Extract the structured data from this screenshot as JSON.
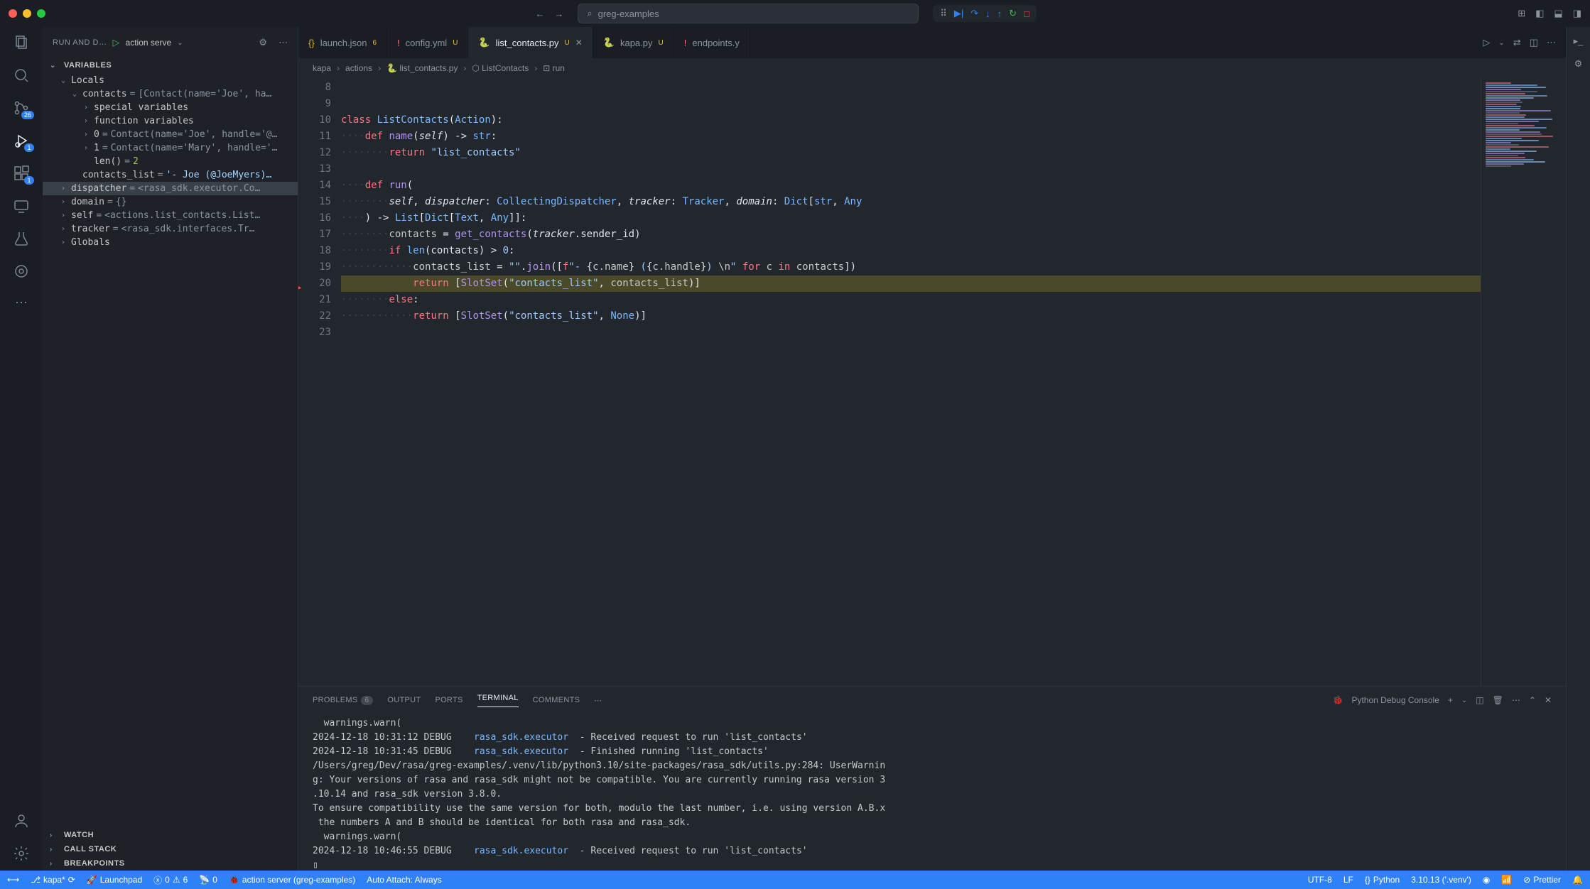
{
  "titlebar": {
    "search_text": "greg-examples"
  },
  "activity": {
    "scm_badge": "26",
    "debug_badge": "1",
    "ext_badge": "1"
  },
  "sidebar": {
    "title": "RUN AND D…",
    "config": "action serve",
    "sections": {
      "variables": "VARIABLES",
      "locals": "Locals",
      "globals": "Globals",
      "watch": "WATCH",
      "callstack": "CALL STACK",
      "breakpoints": "BREAKPOINTS"
    },
    "vars": {
      "contacts": "contacts",
      "contacts_val": "[Contact(name='Joe', ha…",
      "special": "special variables",
      "funcvars": "function variables",
      "idx0": "0",
      "idx0_val": "Contact(name='Joe', handle='@…",
      "idx1": "1",
      "idx1_val": "Contact(name='Mary', handle='…",
      "len": "len()",
      "len_val": "2",
      "clist": "contacts_list",
      "clist_val": "'- Joe (@JoeMyers)…",
      "dispatcher": "dispatcher",
      "dispatcher_val": "<rasa_sdk.executor.Co…",
      "domain": "domain",
      "domain_val": "{}",
      "selfv": "self",
      "self_val": "<actions.list_contacts.List…",
      "tracker": "tracker",
      "tracker_val": "<rasa_sdk.interfaces.Tr…"
    }
  },
  "tabs": [
    {
      "icon": "{}",
      "icon_color": "#e3b341",
      "name": "launch.json",
      "mod": "6"
    },
    {
      "icon": "!",
      "icon_color": "#f97583",
      "name": "config.yml",
      "mod": "U"
    },
    {
      "icon": "py",
      "icon_color": "#79b8ff",
      "name": "list_contacts.py",
      "mod": "U",
      "active": true,
      "close": true
    },
    {
      "icon": "py",
      "icon_color": "#79b8ff",
      "name": "kapa.py",
      "mod": "U"
    },
    {
      "icon": "!",
      "icon_color": "#f97583",
      "name": "endpoints.y"
    }
  ],
  "breadcrumb": [
    "kapa",
    "actions",
    "list_contacts.py",
    "ListContacts",
    "run"
  ],
  "code": {
    "lines": [
      {
        "n": 8,
        "html": ""
      },
      {
        "n": 9,
        "html": ""
      },
      {
        "n": 10,
        "html": "<span class='kw'>class</span> <span class='cls'>ListContacts</span><span class='punct'>(</span><span class='cls'>Action</span><span class='punct'>):</span>"
      },
      {
        "n": 11,
        "html": "<span class='dots'>····</span><span class='kw'>def</span> <span class='fn'>name</span><span class='punct'>(</span><span class='self'>self</span><span class='punct'>) -&gt; </span><span class='builtin'>str</span><span class='punct'>:</span>"
      },
      {
        "n": 12,
        "html": "<span class='dots'>········</span><span class='kw'>return</span> <span class='str'>\"list_contacts\"</span>"
      },
      {
        "n": 13,
        "html": ""
      },
      {
        "n": 14,
        "html": "<span class='dots'>····</span><span class='kw'>def</span> <span class='fn'>run</span><span class='punct'>(</span>"
      },
      {
        "n": 15,
        "html": "<span class='dots'>········</span><span class='self'>self</span><span class='punct'>, </span><span class='param'>dispatcher</span><span class='punct'>: </span><span class='cls'>CollectingDispatcher</span><span class='punct'>, </span><span class='param'>tracker</span><span class='punct'>: </span><span class='cls'>Tracker</span><span class='punct'>, </span><span class='param'>domain</span><span class='punct'>: </span><span class='cls'>Dict</span><span class='punct'>[</span><span class='builtin'>str</span><span class='punct'>, </span><span class='cls'>Any</span>"
      },
      {
        "n": 16,
        "html": "<span class='dots'>····</span><span class='punct'>) -&gt; </span><span class='cls'>List</span><span class='punct'>[</span><span class='cls'>Dict</span><span class='punct'>[</span><span class='cls'>Text</span><span class='punct'>, </span><span class='cls'>Any</span><span class='punct'>]]:</span>"
      },
      {
        "n": 17,
        "html": "<span class='dots'>········</span>contacts <span class='op'>=</span> <span class='fn'>get_contacts</span><span class='punct'>(</span><span class='param'>tracker</span><span class='punct'>.sender_id)</span>"
      },
      {
        "n": 18,
        "html": "<span class='dots'>········</span><span class='kw'>if</span> <span class='builtin'>len</span><span class='punct'>(contacts) &gt; </span><span class='str'>0</span><span class='punct'>:</span>"
      },
      {
        "n": 19,
        "html": "<span class='dots'>············</span>contacts_list <span class='op'>=</span> <span class='str'>\"\"</span><span class='punct'>.</span><span class='fn'>join</span><span class='punct'>([</span><span class='kw'>f</span><span class='str'>\"- </span><span class='punct'>{</span>c.name<span class='punct'>}</span><span class='str'> (</span><span class='punct'>{</span>c.handle<span class='punct'>}</span><span class='str'>) </span>\\n<span class='str'>\"</span> <span class='kw'>for</span> c <span class='kw'>in</span> contacts<span class='punct'>])</span>"
      },
      {
        "n": 20,
        "html": "<span class='dots'>············</span><span class='kw'>return</span> <span class='punct'>[</span><span class='fn'>SlotSet</span><span class='punct'>(</span><span class='str'>\"contacts_list\"</span><span class='punct'>, </span>contacts_list<span class='punct'>)]</span>",
        "current": true,
        "bp": true
      },
      {
        "n": 21,
        "html": "<span class='dots'>········</span><span class='kw'>else</span><span class='punct'>:</span>"
      },
      {
        "n": 22,
        "html": "<span class='dots'>············</span><span class='kw'>return</span> <span class='punct'>[</span><span class='fn'>SlotSet</span><span class='punct'>(</span><span class='str'>\"contacts_list\"</span><span class='punct'>, </span><span class='builtin'>None</span><span class='punct'>)]</span>"
      },
      {
        "n": 23,
        "html": ""
      }
    ]
  },
  "panel": {
    "problems": "PROBLEMS",
    "problems_count": "6",
    "output": "OUTPUT",
    "ports": "PORTS",
    "terminal": "TERMINAL",
    "comments": "COMMENTS",
    "console": "Python Debug Console",
    "terminal_lines": [
      "  warnings.warn(",
      "2024-12-18 10:31:12 DEBUG    rasa_sdk.executor  - Received request to run 'list_contacts'",
      "2024-12-18 10:31:45 DEBUG    rasa_sdk.executor  - Finished running 'list_contacts'",
      "/Users/greg/Dev/rasa/greg-examples/.venv/lib/python3.10/site-packages/rasa_sdk/utils.py:284: UserWarnin",
      "g: Your versions of rasa and rasa_sdk might not be compatible. You are currently running rasa version 3",
      ".10.14 and rasa_sdk version 3.8.0.",
      "To ensure compatibility use the same version for both, modulo the last number, i.e. using version A.B.x",
      " the numbers A and B should be identical for both rasa and rasa_sdk.",
      "  warnings.warn(",
      "2024-12-18 10:46:55 DEBUG    rasa_sdk.executor  - Received request to run 'list_contacts'",
      "▯"
    ]
  },
  "statusbar": {
    "branch": "kapa*",
    "launchpad": "Launchpad",
    "errors": "0",
    "warnings": "6",
    "ports": "0",
    "debug_target": "action server (greg-examples)",
    "auto_attach": "Auto Attach: Always",
    "encoding": "UTF-8",
    "eol": "LF",
    "lang_icon": "{}",
    "lang": "Python",
    "py_version": "3.10.13 ('.venv')",
    "prettier": "Prettier"
  }
}
